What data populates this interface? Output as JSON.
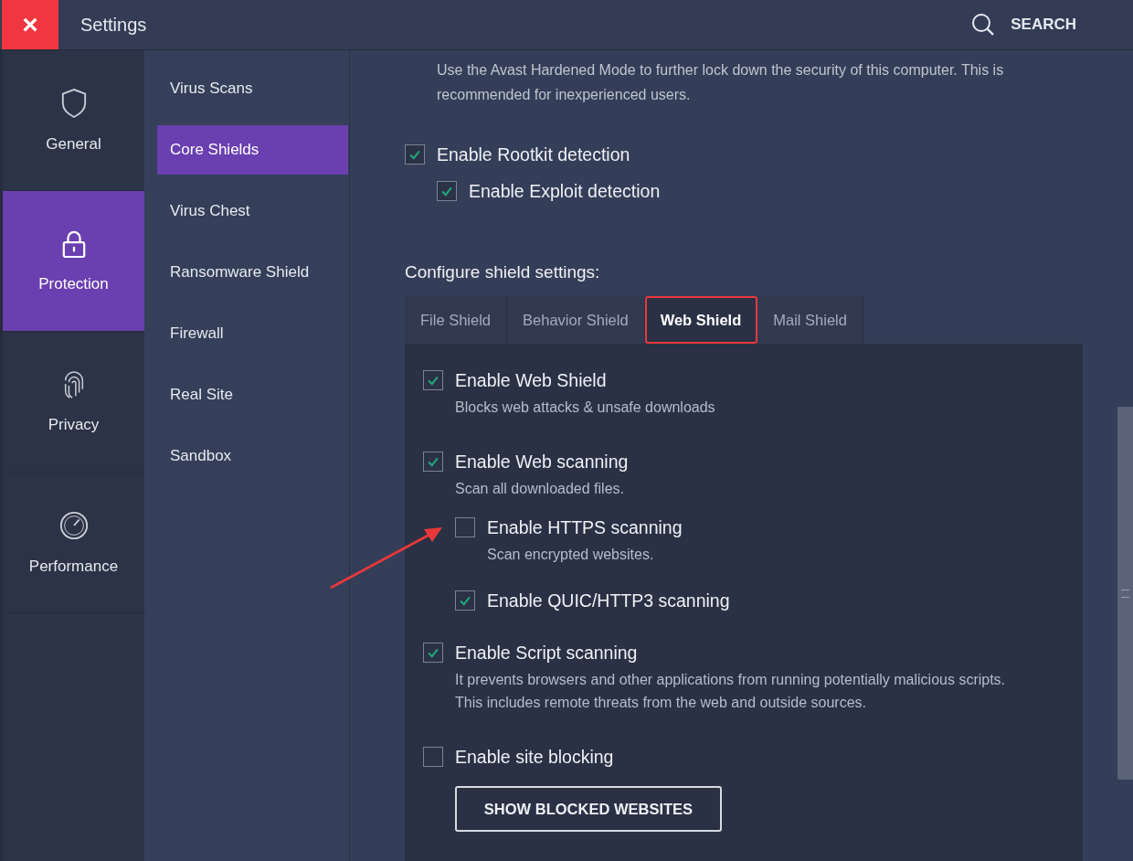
{
  "window": {
    "title": "Settings",
    "close_label": "×",
    "search_label": "SEARCH"
  },
  "rail": [
    {
      "label": "General",
      "selected": false
    },
    {
      "label": "Protection",
      "selected": true
    },
    {
      "label": "Privacy",
      "selected": false
    },
    {
      "label": "Performance",
      "selected": false
    }
  ],
  "submenu": [
    {
      "label": "Virus Scans",
      "selected": false
    },
    {
      "label": "Core Shields",
      "selected": true
    },
    {
      "label": "Virus Chest",
      "selected": false
    },
    {
      "label": "Ransomware Shield",
      "selected": false
    },
    {
      "label": "Firewall",
      "selected": false
    },
    {
      "label": "Real Site",
      "selected": false
    },
    {
      "label": "Sandbox",
      "selected": false
    }
  ],
  "intro": "Use the Avast Hardened Mode to further lock down the security of this computer. This is recommended for inexperienced users.",
  "general_options": [
    {
      "label": "Enable Rootkit detection",
      "checked": true,
      "children": [
        {
          "label": "Enable Exploit detection",
          "checked": true
        }
      ]
    }
  ],
  "section_title": "Configure shield settings:",
  "tabs": [
    {
      "label": "File Shield",
      "selected": false,
      "highlighted": false
    },
    {
      "label": "Behavior Shield",
      "selected": false,
      "highlighted": false
    },
    {
      "label": "Web Shield",
      "selected": true,
      "highlighted": true
    },
    {
      "label": "Mail Shield",
      "selected": false,
      "highlighted": false
    }
  ],
  "web_shield_options": [
    {
      "label": "Enable Web Shield",
      "checked": true,
      "description": "Blocks web attacks & unsafe downloads"
    },
    {
      "label": "Enable Web scanning",
      "checked": true,
      "description": "Scan all downloaded files.",
      "children": [
        {
          "label": "Enable HTTPS scanning",
          "checked": false,
          "description": "Scan encrypted websites."
        },
        {
          "label": "Enable QUIC/HTTP3 scanning",
          "checked": true
        }
      ]
    },
    {
      "label": "Enable Script scanning",
      "checked": true,
      "description": "It prevents browsers and other applications from running potentially malicious scripts. This includes remote threats from the web and outside sources."
    },
    {
      "label": "Enable site blocking",
      "checked": false,
      "button": "SHOW BLOCKED WEBSITES"
    }
  ]
}
